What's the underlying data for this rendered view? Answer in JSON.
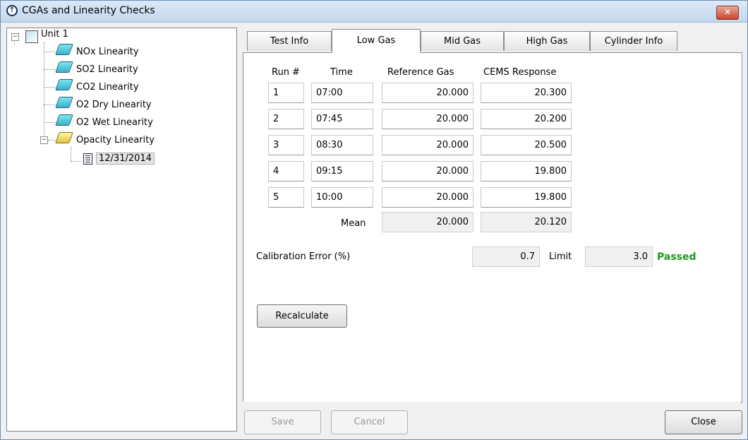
{
  "window": {
    "title": "CGAs and Linearity Checks",
    "close_glyph": "✕"
  },
  "tree": {
    "root": {
      "label": "Unit 1",
      "expander": "−"
    },
    "items": [
      {
        "label": "NOx Linearity"
      },
      {
        "label": "SO2 Linearity"
      },
      {
        "label": "CO2 Linearity"
      },
      {
        "label": "O2 Dry Linearity"
      },
      {
        "label": "O2 Wet Linearity"
      },
      {
        "label": "Opacity Linearity",
        "expander": "−"
      }
    ],
    "child": {
      "label": "12/31/2014"
    }
  },
  "tabs": [
    {
      "label": "Test Info"
    },
    {
      "label": "Low Gas"
    },
    {
      "label": "Mid Gas"
    },
    {
      "label": "High Gas"
    },
    {
      "label": "Cylinder Info"
    }
  ],
  "grid": {
    "headers": {
      "run": "Run #",
      "time": "Time",
      "ref": "Reference Gas",
      "cems": "CEMS Response"
    },
    "rows": [
      {
        "run": "1",
        "time": "07:00",
        "ref": "20.000",
        "cems": "20.300"
      },
      {
        "run": "2",
        "time": "07:45",
        "ref": "20.000",
        "cems": "20.200"
      },
      {
        "run": "3",
        "time": "08:30",
        "ref": "20.000",
        "cems": "20.500"
      },
      {
        "run": "4",
        "time": "09:15",
        "ref": "20.000",
        "cems": "19.800"
      },
      {
        "run": "5",
        "time": "10:00",
        "ref": "20.000",
        "cems": "19.800"
      }
    ],
    "mean": {
      "label": "Mean",
      "ref": "20.000",
      "cems": "20.120"
    }
  },
  "calibration": {
    "label": "Calibration Error (%)",
    "value": "0.7",
    "limit_label": "Limit",
    "limit_value": "3.0",
    "status": "Passed"
  },
  "buttons": {
    "recalculate": "Recalculate",
    "save": "Save",
    "cancel": "Cancel",
    "close": "Close"
  },
  "colors": {
    "passed": "#1a9a1a",
    "accent": "#34b4cc"
  }
}
